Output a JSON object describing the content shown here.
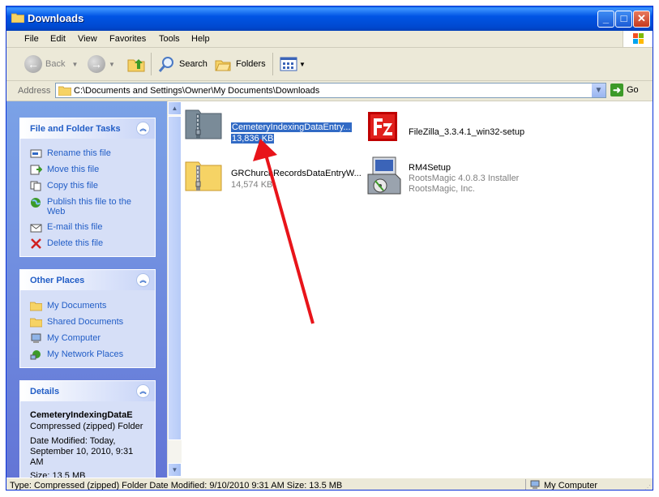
{
  "window": {
    "title": "Downloads",
    "minimize": "_",
    "maximize": "□",
    "close": "✕"
  },
  "menu": [
    "File",
    "Edit",
    "View",
    "Favorites",
    "Tools",
    "Help"
  ],
  "toolbar": {
    "back": "Back",
    "search": "Search",
    "folders": "Folders",
    "icons": [
      "back-arrow-icon",
      "forward-arrow-icon",
      "up-folder-icon",
      "search-icon",
      "folders-icon",
      "views-icon"
    ]
  },
  "address": {
    "label": "Address",
    "path": "C:\\Documents and Settings\\Owner\\My Documents\\Downloads",
    "go": "Go"
  },
  "sidebar": {
    "file_tasks": {
      "title": "File and Folder Tasks",
      "items": [
        "Rename this file",
        "Move this file",
        "Copy this file",
        "Publish this file to the Web",
        "E-mail this file",
        "Delete this file"
      ]
    },
    "other_places": {
      "title": "Other Places",
      "items": [
        "My Documents",
        "Shared Documents",
        "My Computer",
        "My Network Places"
      ]
    },
    "details": {
      "title": "Details",
      "name": "CemeteryIndexingDataE",
      "type": "Compressed (zipped) Folder",
      "modified_label": "Date Modified: Today,",
      "modified_date": "September 10, 2010, 9:31",
      "modified_ampm": "AM",
      "size": "Size: 13.5 MB"
    }
  },
  "files": [
    {
      "name": "CemeteryIndexingDataEntry...",
      "sub": "13,836 KB",
      "selected": true
    },
    {
      "name": "FileZilla_3.3.4.1_win32-setup",
      "sub": "",
      "selected": false
    },
    {
      "name": "GRChurchRecordsDataEntryW...",
      "sub": "14,574 KB",
      "selected": false
    },
    {
      "name": "RM4Setup",
      "sub": "RootsMagic 4.0.8.3 Installer",
      "sub2": "RootsMagic, Inc.",
      "selected": false
    }
  ],
  "status": {
    "text": "Type: Compressed (zipped) Folder Date Modified: 9/10/2010 9:31 AM Size: 13.5 MB",
    "zone": "My Computer"
  },
  "colors": {
    "title_bar": "#0055e5",
    "selection": "#316ac5",
    "task_link": "#215dc6",
    "annotation_arrow": "#e8141a"
  }
}
